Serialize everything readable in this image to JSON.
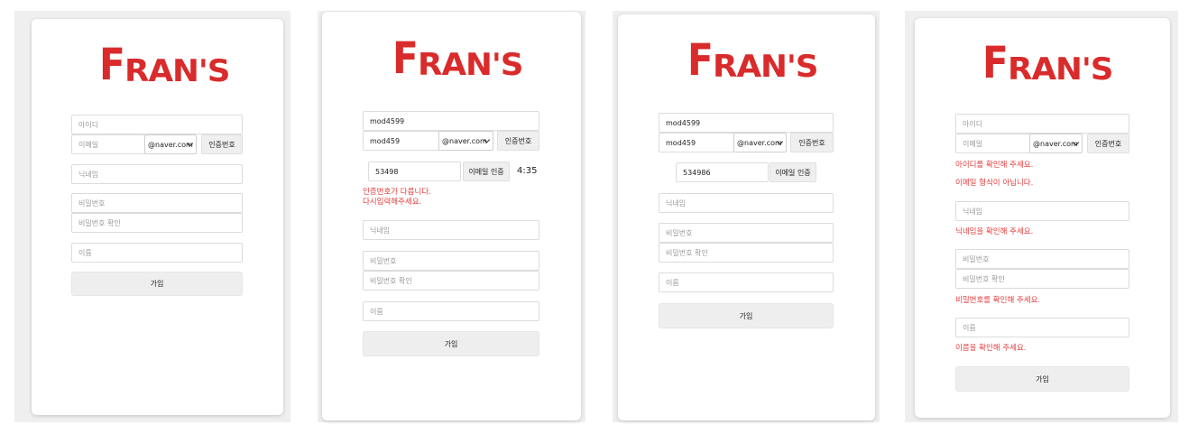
{
  "brand": {
    "logo_big": "F",
    "logo_rest": "RAN'S",
    "logo_color": "#d92b2b",
    "error_color": "#e53b3b"
  },
  "labels": {
    "id_placeholder": "아이디",
    "email_placeholder": "이메일",
    "domain": "@naver.com",
    "verify_button": "인증번호",
    "nickname_placeholder": "닉네임",
    "password_placeholder": "비밀번호",
    "password_confirm_placeholder": "비밀번호 확인",
    "name_placeholder": "이름",
    "join_button": "가입",
    "email_verify_button": "이메일 인증"
  },
  "screen2": {
    "id_value": "mod4599",
    "email_value": "mod459",
    "code_value": "53498",
    "timer": "4:35",
    "error_line1": "인증번호가 다릅니다.",
    "error_line2": "다시입력해주세요."
  },
  "screen3": {
    "id_value": "mod4599",
    "email_value": "mod459",
    "code_value": "534986"
  },
  "screen4": {
    "id_error": "아이디를 확인해 주세요.",
    "email_error": "이메일 형식이 아닙니다.",
    "nickname_error": "닉네임을 확인해 주세요.",
    "password_error": "비밀번호를 확인해 주세요.",
    "name_error": "이름을 확인해 주세요."
  }
}
